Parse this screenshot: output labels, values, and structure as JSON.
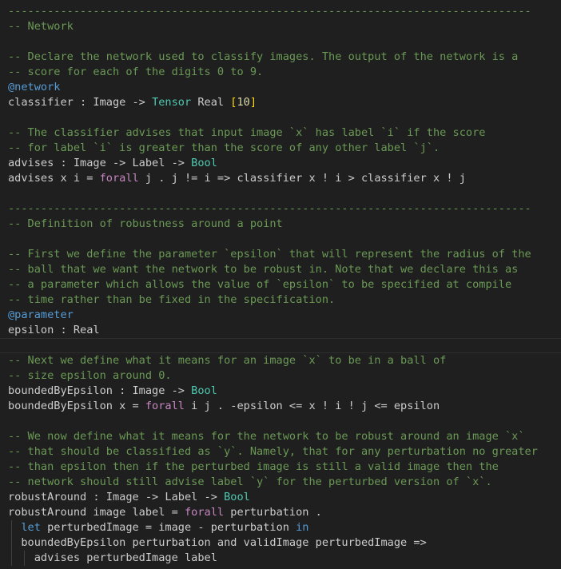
{
  "editor": {
    "colors": {
      "background": "#1f1f1f",
      "comment": "#6a9955",
      "decorator": "#569cd6",
      "keyword": "#c586c0",
      "keyword_blue": "#569cd6",
      "type": "#4ec9b0",
      "builtin": "#dcdcaa",
      "bracket": "#ffd700",
      "text": "#cccccc"
    },
    "lines": [
      {
        "tokens": [
          {
            "t": "--------------------------------------------------------------------------------",
            "c": "comment"
          }
        ]
      },
      {
        "tokens": [
          {
            "t": "-- Network",
            "c": "comment"
          }
        ]
      },
      {
        "tokens": []
      },
      {
        "tokens": [
          {
            "t": "-- Declare the network used to classify images. The output of the network is a",
            "c": "comment"
          }
        ]
      },
      {
        "tokens": [
          {
            "t": "-- score for each of the digits 0 to 9.",
            "c": "comment"
          }
        ]
      },
      {
        "tokens": [
          {
            "t": "@network",
            "c": "decorator"
          }
        ]
      },
      {
        "tokens": [
          {
            "t": "classifier : Image -> ",
            "c": "plain"
          },
          {
            "t": "Tensor",
            "c": "type"
          },
          {
            "t": " Real ",
            "c": "plain"
          },
          {
            "t": "[",
            "c": "bracket"
          },
          {
            "t": "10",
            "c": "number"
          },
          {
            "t": "]",
            "c": "bracket"
          }
        ]
      },
      {
        "tokens": []
      },
      {
        "tokens": [
          {
            "t": "-- The classifier advises that input image `x` has label `i` if the score",
            "c": "comment"
          }
        ]
      },
      {
        "tokens": [
          {
            "t": "-- for label `i` is greater than the score of any other label `j`.",
            "c": "comment"
          }
        ]
      },
      {
        "tokens": [
          {
            "t": "advises : Image -> Label -> ",
            "c": "plain"
          },
          {
            "t": "Bool",
            "c": "type"
          }
        ]
      },
      {
        "tokens": [
          {
            "t": "advises x i = ",
            "c": "plain"
          },
          {
            "t": "forall",
            "c": "keyword"
          },
          {
            "t": " j . j != i => classifier x ! i > classifier x ! j",
            "c": "plain"
          }
        ]
      },
      {
        "tokens": []
      },
      {
        "tokens": [
          {
            "t": "--------------------------------------------------------------------------------",
            "c": "comment"
          }
        ]
      },
      {
        "tokens": [
          {
            "t": "-- Definition of robustness around a point",
            "c": "comment"
          }
        ]
      },
      {
        "tokens": []
      },
      {
        "tokens": [
          {
            "t": "-- First we define the parameter `epsilon` that will represent the radius of the",
            "c": "comment"
          }
        ]
      },
      {
        "tokens": [
          {
            "t": "-- ball that we want the network to be robust in. Note that we declare this as",
            "c": "comment"
          }
        ]
      },
      {
        "tokens": [
          {
            "t": "-- a parameter which allows the value of `epsilon` to be specified at compile",
            "c": "comment"
          }
        ]
      },
      {
        "tokens": [
          {
            "t": "-- time rather than be fixed in the specification.",
            "c": "comment"
          }
        ]
      },
      {
        "tokens": [
          {
            "t": "@parameter",
            "c": "decorator"
          }
        ]
      },
      {
        "tokens": [
          {
            "t": "epsilon : Real",
            "c": "plain"
          }
        ]
      },
      {
        "tokens": [],
        "current": true
      },
      {
        "tokens": [
          {
            "t": "-- Next we define what it means for an image `x` to be in a ball of",
            "c": "comment"
          }
        ]
      },
      {
        "tokens": [
          {
            "t": "-- size epsilon around 0.",
            "c": "comment"
          }
        ]
      },
      {
        "tokens": [
          {
            "t": "boundedByEpsilon : Image -> ",
            "c": "plain"
          },
          {
            "t": "Bool",
            "c": "type"
          }
        ]
      },
      {
        "tokens": [
          {
            "t": "boundedByEpsilon x = ",
            "c": "plain"
          },
          {
            "t": "forall",
            "c": "keyword"
          },
          {
            "t": " i j . -epsilon <= x ! i ! j <= epsilon",
            "c": "plain"
          }
        ]
      },
      {
        "tokens": []
      },
      {
        "tokens": [
          {
            "t": "-- We now define what it means for the network to be robust around an image `x`",
            "c": "comment"
          }
        ]
      },
      {
        "tokens": [
          {
            "t": "-- that should be classified as `y`. Namely, that for any perturbation no greater",
            "c": "comment"
          }
        ]
      },
      {
        "tokens": [
          {
            "t": "-- than epsilon then if the perturbed image is still a valid image then the",
            "c": "comment"
          }
        ]
      },
      {
        "tokens": [
          {
            "t": "-- network should still advise label `y` for the perturbed version of `x`.",
            "c": "comment"
          }
        ]
      },
      {
        "tokens": [
          {
            "t": "robustAround : Image -> Label -> ",
            "c": "plain"
          },
          {
            "t": "Bool",
            "c": "type"
          }
        ]
      },
      {
        "tokens": [
          {
            "t": "robustAround image label = ",
            "c": "plain"
          },
          {
            "t": "forall",
            "c": "keyword"
          },
          {
            "t": " perturbation .",
            "c": "plain"
          }
        ]
      },
      {
        "tokens": [
          {
            "t": "  ",
            "c": "plain"
          },
          {
            "t": "let",
            "c": "keyword-blue"
          },
          {
            "t": " perturbedImage = image - perturbation ",
            "c": "plain"
          },
          {
            "t": "in",
            "c": "keyword-blue"
          }
        ],
        "indent": 1
      },
      {
        "tokens": [
          {
            "t": "  boundedByEpsilon perturbation and validImage perturbedImage =>",
            "c": "plain"
          }
        ],
        "indent": 1
      },
      {
        "tokens": [
          {
            "t": "    advises perturbedImage label",
            "c": "plain"
          }
        ],
        "indent": 2
      }
    ]
  }
}
